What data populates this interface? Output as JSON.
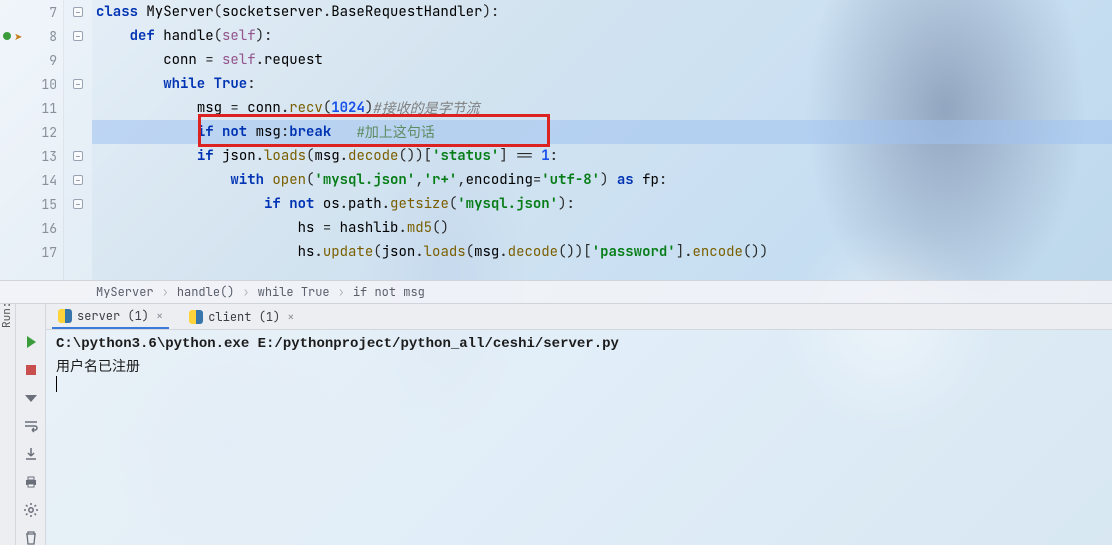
{
  "editor": {
    "lines": [
      {
        "n": 7,
        "indent": 0,
        "fold": true,
        "tokens": [
          {
            "t": "kw",
            "v": "class "
          },
          {
            "t": "id",
            "v": "MyServer"
          },
          {
            "t": "op",
            "v": "("
          },
          {
            "t": "id",
            "v": "socketserver"
          },
          {
            "t": "op",
            "v": "."
          },
          {
            "t": "id",
            "v": "BaseRequestHandler"
          },
          {
            "t": "op",
            "v": ")"
          },
          {
            "t": "op",
            "v": ":"
          }
        ]
      },
      {
        "n": 8,
        "indent": 1,
        "fold": true,
        "mod": true,
        "arrow": true,
        "tokens": [
          {
            "t": "kw",
            "v": "def "
          },
          {
            "t": "def",
            "v": "handle"
          },
          {
            "t": "op",
            "v": "("
          },
          {
            "t": "self",
            "v": "self"
          },
          {
            "t": "op",
            "v": ")"
          },
          {
            "t": "op",
            "v": ":"
          }
        ]
      },
      {
        "n": 9,
        "indent": 2,
        "tokens": [
          {
            "t": "id",
            "v": "conn"
          },
          {
            "t": "op",
            "v": " = "
          },
          {
            "t": "self",
            "v": "self"
          },
          {
            "t": "op",
            "v": "."
          },
          {
            "t": "id",
            "v": "request"
          }
        ]
      },
      {
        "n": 10,
        "indent": 2,
        "fold": true,
        "tokens": [
          {
            "t": "kw",
            "v": "while "
          },
          {
            "t": "kw",
            "v": "True"
          },
          {
            "t": "op",
            "v": ":"
          }
        ]
      },
      {
        "n": 11,
        "indent": 3,
        "tokens": [
          {
            "t": "id",
            "v": "msg"
          },
          {
            "t": "op",
            "v": " = "
          },
          {
            "t": "id",
            "v": "conn"
          },
          {
            "t": "op",
            "v": "."
          },
          {
            "t": "fn",
            "v": "recv"
          },
          {
            "t": "op",
            "v": "("
          },
          {
            "t": "num",
            "v": "1024"
          },
          {
            "t": "op",
            "v": ")"
          },
          {
            "t": "cmt",
            "v": "#接收的是字节流"
          }
        ]
      },
      {
        "n": 12,
        "indent": 3,
        "hl": true,
        "redbox": true,
        "tokens": [
          {
            "t": "kw",
            "v": "if not "
          },
          {
            "t": "id",
            "v": "msg"
          },
          {
            "t": "op",
            "v": ":"
          },
          {
            "t": "brk",
            "v": "break"
          },
          {
            "t": "op",
            "v": "   "
          },
          {
            "t": "cmt2",
            "v": "#加上这句话"
          }
        ]
      },
      {
        "n": 13,
        "indent": 3,
        "fold": true,
        "tokens": [
          {
            "t": "kw",
            "v": "if "
          },
          {
            "t": "id",
            "v": "json"
          },
          {
            "t": "op",
            "v": "."
          },
          {
            "t": "fn",
            "v": "loads"
          },
          {
            "t": "op",
            "v": "("
          },
          {
            "t": "id",
            "v": "msg"
          },
          {
            "t": "op",
            "v": "."
          },
          {
            "t": "fn",
            "v": "decode"
          },
          {
            "t": "op",
            "v": "())["
          },
          {
            "t": "str",
            "v": "'status'"
          },
          {
            "t": "op",
            "v": "] == "
          },
          {
            "t": "num",
            "v": "1"
          },
          {
            "t": "op",
            "v": ":"
          }
        ]
      },
      {
        "n": 14,
        "indent": 4,
        "fold": true,
        "tokens": [
          {
            "t": "kw",
            "v": "with "
          },
          {
            "t": "fn",
            "v": "open"
          },
          {
            "t": "op",
            "v": "("
          },
          {
            "t": "str",
            "v": "'mysql.json'"
          },
          {
            "t": "op",
            "v": ","
          },
          {
            "t": "str",
            "v": "'r+'"
          },
          {
            "t": "op",
            "v": ","
          },
          {
            "t": "id",
            "v": "encoding"
          },
          {
            "t": "op",
            "v": "="
          },
          {
            "t": "str",
            "v": "'utf-8'"
          },
          {
            "t": "op",
            "v": ") "
          },
          {
            "t": "kw",
            "v": "as "
          },
          {
            "t": "id",
            "v": "fp"
          },
          {
            "t": "op",
            "v": ":"
          }
        ]
      },
      {
        "n": 15,
        "indent": 5,
        "fold": true,
        "tokens": [
          {
            "t": "kw",
            "v": "if not "
          },
          {
            "t": "id",
            "v": "os"
          },
          {
            "t": "op",
            "v": "."
          },
          {
            "t": "id",
            "v": "path"
          },
          {
            "t": "op",
            "v": "."
          },
          {
            "t": "fn",
            "v": "getsize"
          },
          {
            "t": "op",
            "v": "("
          },
          {
            "t": "str",
            "v": "'mysql.json'"
          },
          {
            "t": "op",
            "v": ")"
          },
          {
            "t": "op",
            "v": ":"
          }
        ]
      },
      {
        "n": 16,
        "indent": 6,
        "tokens": [
          {
            "t": "id",
            "v": "hs"
          },
          {
            "t": "op",
            "v": " = "
          },
          {
            "t": "id",
            "v": "hashlib"
          },
          {
            "t": "op",
            "v": "."
          },
          {
            "t": "fn",
            "v": "md5"
          },
          {
            "t": "op",
            "v": "()"
          }
        ]
      },
      {
        "n": 17,
        "indent": 6,
        "tokens": [
          {
            "t": "id",
            "v": "hs"
          },
          {
            "t": "op",
            "v": "."
          },
          {
            "t": "fn",
            "v": "update"
          },
          {
            "t": "op",
            "v": "("
          },
          {
            "t": "id",
            "v": "json"
          },
          {
            "t": "op",
            "v": "."
          },
          {
            "t": "fn",
            "v": "loads"
          },
          {
            "t": "op",
            "v": "("
          },
          {
            "t": "id",
            "v": "msg"
          },
          {
            "t": "op",
            "v": "."
          },
          {
            "t": "fn",
            "v": "decode"
          },
          {
            "t": "op",
            "v": "())["
          },
          {
            "t": "str",
            "v": "'password'"
          },
          {
            "t": "op",
            "v": "]."
          },
          {
            "t": "fn",
            "v": "encode"
          },
          {
            "t": "op",
            "v": "())"
          }
        ]
      }
    ]
  },
  "breadcrumb": {
    "items": [
      "MyServer",
      "handle()",
      "while True",
      "if not msg"
    ]
  },
  "run": {
    "label": "Run:",
    "tabs": [
      {
        "label": "server (1)",
        "active": true
      },
      {
        "label": "client (1)",
        "active": false
      }
    ],
    "console": {
      "cmd": "C:\\python3.6\\python.exe E:/pythonproject/python_all/ceshi/server.py",
      "out": "用户名已注册"
    },
    "toolbar": [
      "rerun",
      "stop",
      "down",
      "wrap",
      "export",
      "print",
      "gear",
      "trash"
    ]
  }
}
